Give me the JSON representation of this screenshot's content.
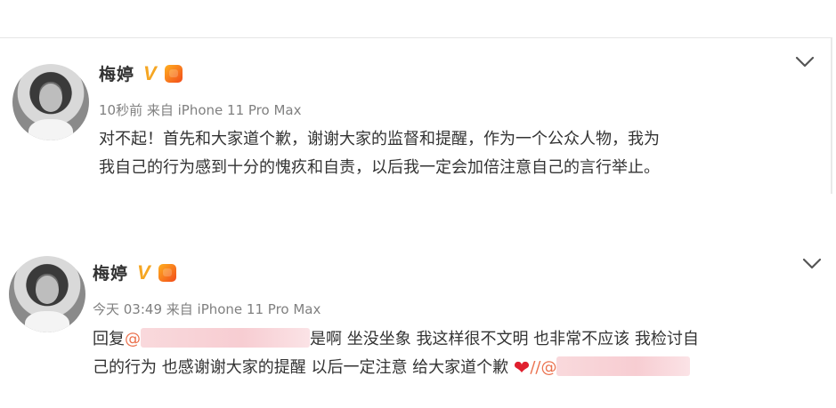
{
  "posts": [
    {
      "name": "梅婷",
      "verified_mark": "V",
      "meta": "10秒前 来自 iPhone 11 Pro Max",
      "content_line1": "对不起！首先和大家道个歉，谢谢大家的监督和提醒，作为一个公众人物，我为",
      "content_line2": "我自己的行为感到十分的愧疚和自责，以后我一定会加倍注意自己的言行举止。"
    },
    {
      "name": "梅婷",
      "verified_mark": "V",
      "meta": "今天 03:49 来自 iPhone 11 Pro Max",
      "reply_prefix": "回复",
      "at_sign": "@",
      "content_line1_rest": "是啊 坐没坐象 我这样很不文明 也非常不应该 我检讨自",
      "content_line2": "己的行为 也感谢谢大家的提醒 以后一定注意 给大家道个歉",
      "repost_marker": "//@"
    }
  ],
  "icons": {
    "menu": "chevron-down-icon",
    "badge": "member-badge-icon",
    "heart": "heart-emoji"
  },
  "colors": {
    "verified": "#f5a623",
    "mention": "#eb7350",
    "heart": "#e0202e",
    "meta": "#808080"
  }
}
